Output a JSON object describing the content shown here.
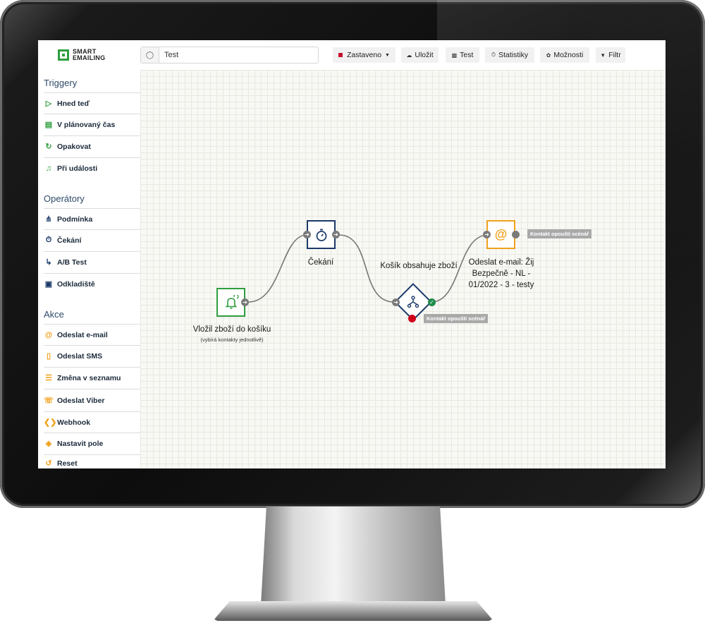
{
  "app": {
    "logo_line1": "SMART",
    "logo_line2": "EMAILING"
  },
  "toolbar": {
    "search_value": "Test",
    "status_label": "Zastaveno",
    "save_label": "Uložit",
    "test_label": "Test",
    "stats_label": "Statistiky",
    "options_label": "Možnosti",
    "filter_label": "Filtr"
  },
  "sidebar": {
    "triggers_title": "Triggery",
    "triggers": [
      {
        "label": "Hned teď",
        "icon": "play-icon"
      },
      {
        "label": "V plánovaný čas",
        "icon": "calendar-icon"
      },
      {
        "label": "Opakovat",
        "icon": "repeat-icon"
      },
      {
        "label": "Při události",
        "icon": "bell-icon"
      }
    ],
    "operators_title": "Operátory",
    "operators": [
      {
        "label": "Podmínka",
        "icon": "branch-icon"
      },
      {
        "label": "Čekání",
        "icon": "stopwatch-icon"
      },
      {
        "label": "A/B Test",
        "icon": "split-icon"
      },
      {
        "label": "Odkladiště",
        "icon": "archive-icon"
      }
    ],
    "actions_title": "Akce",
    "actions": [
      {
        "label": "Odeslat e-mail",
        "icon": "at-icon"
      },
      {
        "label": "Odeslat SMS",
        "icon": "phone-icon"
      },
      {
        "label": "Změna v seznamu",
        "icon": "list-icon"
      },
      {
        "label": "Odeslat Viber",
        "icon": "viber-icon"
      },
      {
        "label": "Webhook",
        "icon": "webhook-icon"
      },
      {
        "label": "Nastavit pole",
        "icon": "tag-icon"
      },
      {
        "label": "Reset",
        "icon": "reset-icon"
      }
    ]
  },
  "flow": {
    "trigger_label": "Vložil zboží do košíku",
    "trigger_sub": "(vybírá kontakty jednotlivě)",
    "wait_label": "Čekání",
    "condition_label": "Košík obsahuje zboží",
    "condition_exit_tag": "Kontakt opouští scénář",
    "email_label_line1": "Odeslat e-mail: Žij",
    "email_label_line2": "Bezpečně - NL -",
    "email_label_line3": "01/2022 - 3 - testy",
    "email_exit_tag": "Kontakt opouští scénář"
  },
  "colors": {
    "green": "#2e9e3e",
    "navy": "#1b3a6a",
    "orange": "#f0a21c",
    "red": "#d0021b"
  }
}
